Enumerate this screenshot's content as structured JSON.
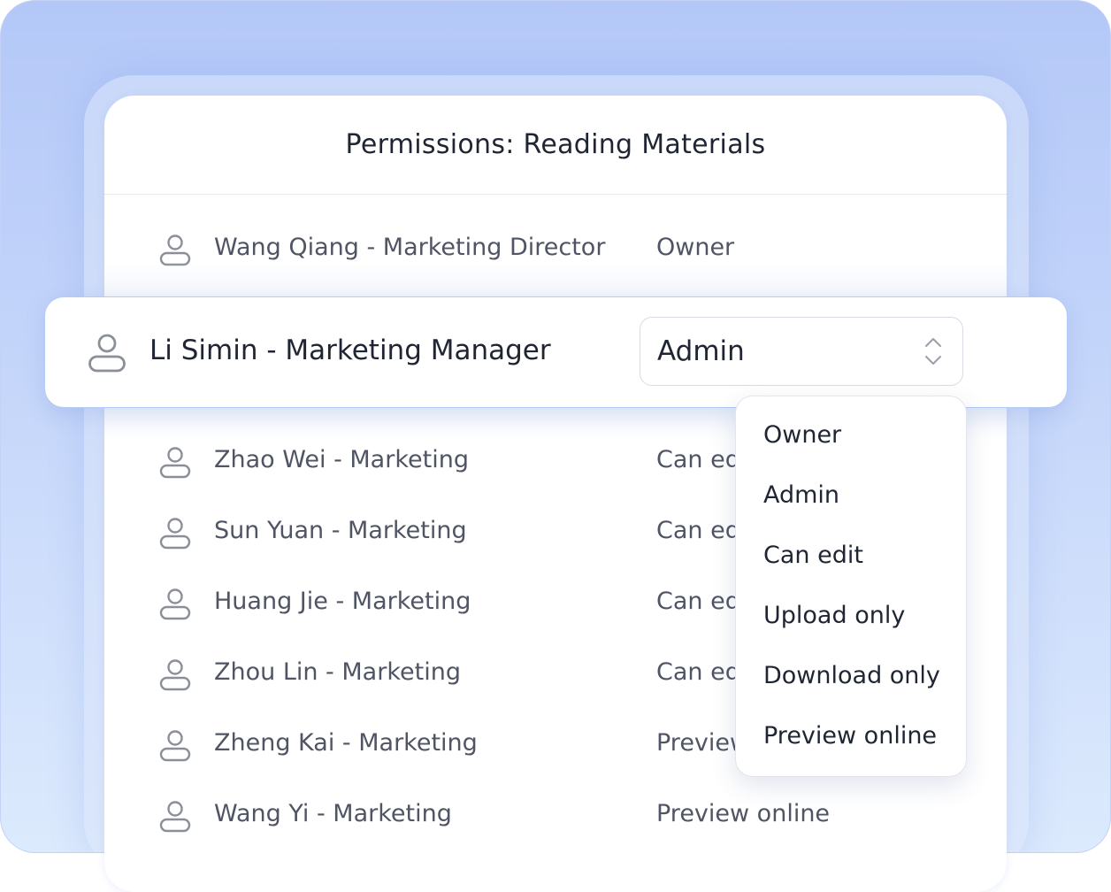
{
  "dialog": {
    "title": "Permissions: Reading Materials"
  },
  "members": [
    {
      "name": "Wang Qiang - Marketing Director",
      "role": "Owner"
    },
    {
      "name": "Zhao Wei - Marketing",
      "role": "Can edit"
    },
    {
      "name": "Sun Yuan - Marketing",
      "role": "Can edit"
    },
    {
      "name": "Huang Jie - Marketing",
      "role": "Can edit"
    },
    {
      "name": "Zhou Lin - Marketing",
      "role": "Can edit"
    },
    {
      "name": "Zheng Kai - Marketing",
      "role": "Preview online"
    },
    {
      "name": "Wang Yi - Marketing",
      "role": "Preview online"
    }
  ],
  "selected_member": {
    "name": "Li Simin - Marketing Manager",
    "role": "Admin"
  },
  "role_options": [
    "Owner",
    "Admin",
    "Can edit",
    "Upload only",
    "Download only",
    "Preview online"
  ],
  "icons": {
    "person": "person-outline-icon",
    "select": "chevron-up-down-icon"
  },
  "colors": {
    "background_top": "#b4c8f8",
    "background_bottom": "#dceafd",
    "selected_border": "#b3cbf6",
    "text_primary": "#1f2533",
    "text_secondary": "#4f5564",
    "icon_gray": "#8a8f98"
  }
}
